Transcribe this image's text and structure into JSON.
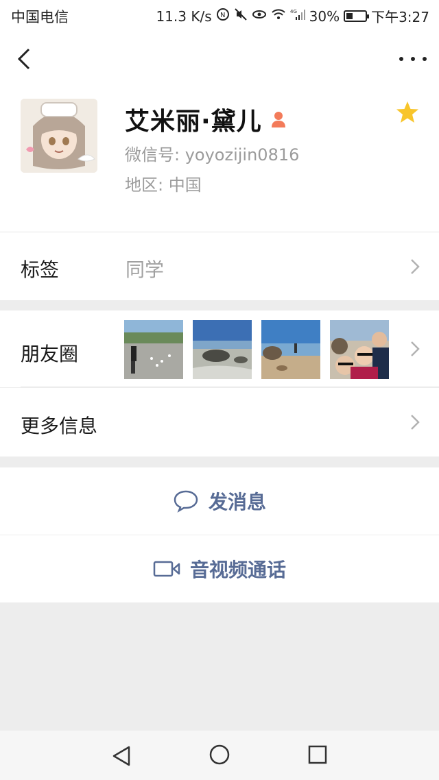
{
  "status_bar": {
    "carrier": "中国电信",
    "speed": "11.3 K/s",
    "network": "4G",
    "battery": "30%",
    "time": "下午3:27"
  },
  "nav": {
    "back_icon": "chevron-left-icon",
    "more_icon": "more-dots-icon"
  },
  "profile": {
    "name": "艾米丽·黛儿",
    "wechat_id": "微信号: yoyozijin0816",
    "region": "地区: 中国",
    "gender_icon": "female-icon",
    "star_color": "#f8c52b"
  },
  "tags": {
    "label": "标签",
    "value": "同学"
  },
  "moments": {
    "label": "朋友圈"
  },
  "more_info": {
    "label": "更多信息"
  },
  "actions": {
    "message_label": "发消息",
    "call_label": "音视频通话",
    "accent": "#576b95"
  },
  "system_nav": {
    "back": "triangle-back-icon",
    "home": "circle-home-icon",
    "recent": "square-recent-icon"
  }
}
